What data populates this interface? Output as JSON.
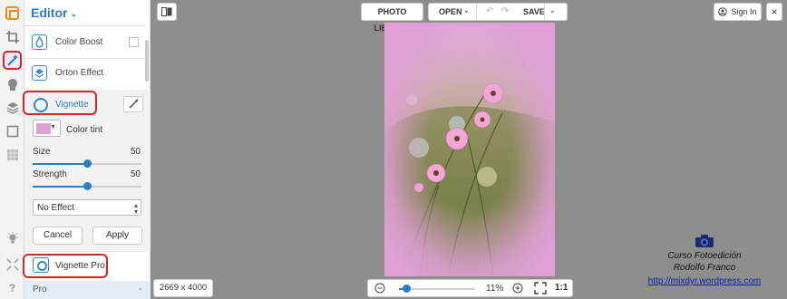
{
  "panel": {
    "title": "Editor",
    "items": [
      {
        "label": "Color Boost"
      },
      {
        "label": "Orton Effect"
      }
    ],
    "vignette": {
      "label": "Vignette",
      "tint_label": "Color tint",
      "tint_color": "#e0a0d4",
      "size_label": "Size",
      "size_value": "50",
      "size_level": 0.5,
      "strength_label": "Strength",
      "strength_value": "50",
      "strength_level": 0.5,
      "effect_select": "No Effect",
      "cancel_label": "Cancel",
      "apply_label": "Apply"
    },
    "vignette_pro": {
      "label": "Vignette Pro"
    },
    "pro_dropdown": "Pro"
  },
  "toolbar": {
    "photo_library": "PHOTO LIBRARY",
    "open": "OPEN",
    "save": "SAVE",
    "sign_in": "Sign In",
    "close": "×"
  },
  "bottom": {
    "dimensions": "2669 x 4000",
    "zoom_percent": "11%",
    "zoom_level": 0.1,
    "one_to_one": "1:1"
  },
  "watermark": {
    "line1": "Curso Fotoedición",
    "line2": "Rodolfo Franco",
    "link": "http://mixdyr.wordpress.com"
  },
  "colors": {
    "accent": "#2d7cc0",
    "highlight": "#d9252a",
    "canvas": "#8e8e8e"
  }
}
